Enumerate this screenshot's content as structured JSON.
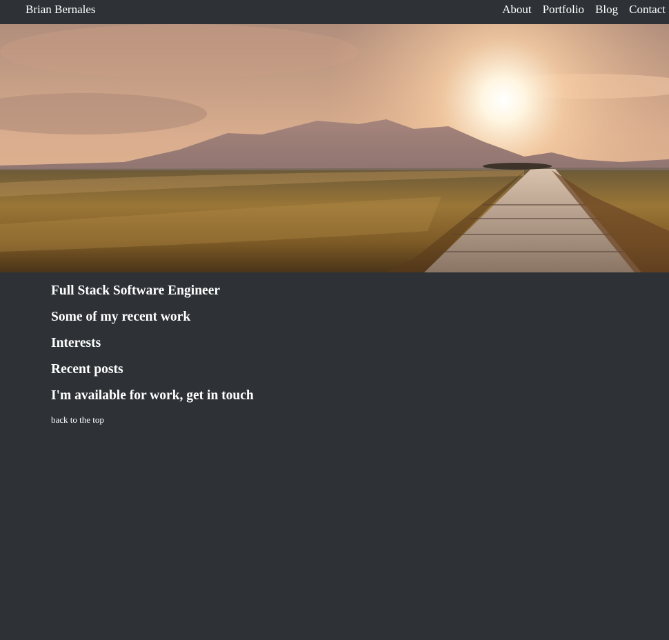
{
  "header": {
    "brand": "Brian Bernales",
    "nav": [
      {
        "label": "About"
      },
      {
        "label": "Portfolio"
      },
      {
        "label": "Blog"
      },
      {
        "label": "Contact"
      }
    ]
  },
  "hero": {
    "image": "sunset-wheat-field-with-path",
    "colors": {
      "sky_top": "#c9a48b",
      "sky_glow": "#fff4dc",
      "mountains": "#9c7f79",
      "field": "#8a6a35",
      "path": "#b8a595"
    }
  },
  "sections": [
    {
      "heading": "Full Stack Software Engineer"
    },
    {
      "heading": "Some of my recent work"
    },
    {
      "heading": "Interests"
    },
    {
      "heading": "Recent posts"
    },
    {
      "heading": "I'm available for work, get in touch"
    }
  ],
  "footer": {
    "back_to_top": "back to the top"
  },
  "theme": {
    "background": "#2e3236",
    "text": "#ffffff"
  }
}
